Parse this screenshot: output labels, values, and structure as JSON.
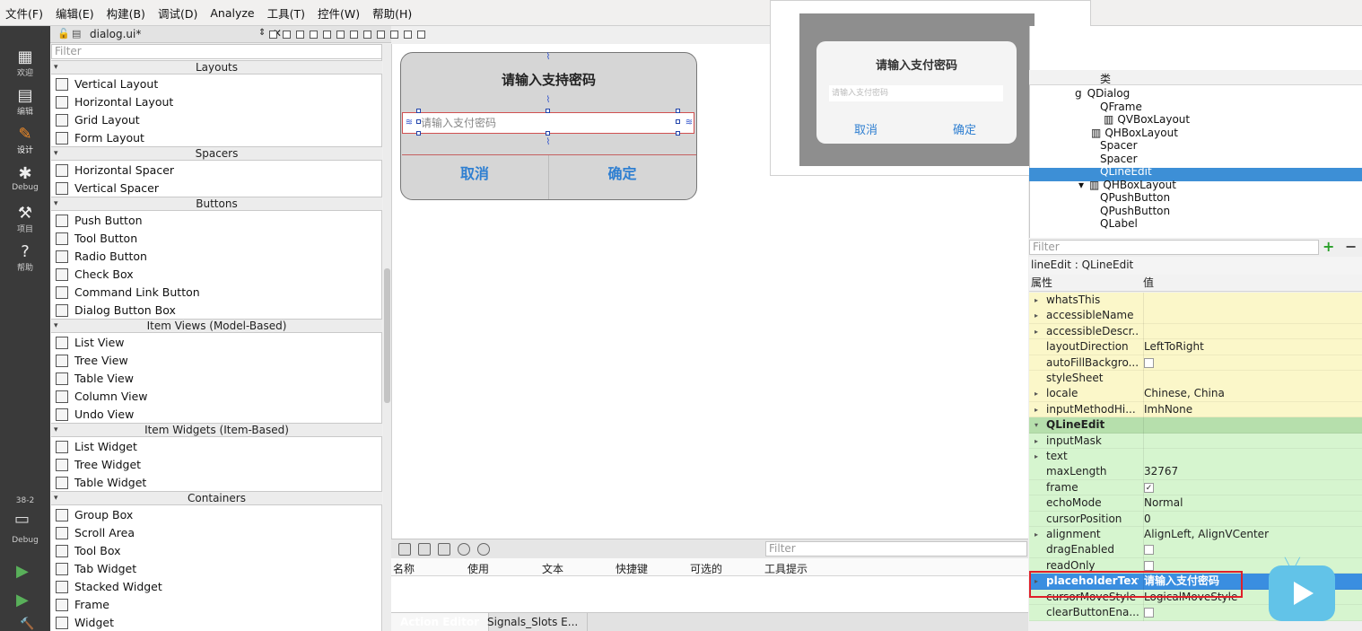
{
  "menubar": [
    "文件(F)",
    "编辑(E)",
    "构建(B)",
    "调试(D)",
    "Analyze",
    "工具(T)",
    "控件(W)",
    "帮助(H)"
  ],
  "modes": [
    {
      "label": "欢迎",
      "icon": "grid-icon"
    },
    {
      "label": "编辑",
      "icon": "document-icon"
    },
    {
      "label": "设计",
      "icon": "pencil-icon"
    },
    {
      "label": "Debug",
      "icon": "bug-icon"
    },
    {
      "label": "项目",
      "icon": "wrench-icon"
    },
    {
      "label": "帮助",
      "icon": "help-icon"
    }
  ],
  "kit": {
    "label": "38-2",
    "mode": "Debug"
  },
  "editor": {
    "file_name": "dialog.ui*"
  },
  "widgetbox": {
    "filter_placeholder": "Filter",
    "categories": [
      {
        "name": "Layouts",
        "items": [
          "Vertical Layout",
          "Horizontal Layout",
          "Grid Layout",
          "Form Layout"
        ]
      },
      {
        "name": "Spacers",
        "items": [
          "Horizontal Spacer",
          "Vertical Spacer"
        ]
      },
      {
        "name": "Buttons",
        "items": [
          "Push Button",
          "Tool Button",
          "Radio Button",
          "Check Box",
          "Command Link Button",
          "Dialog Button Box"
        ]
      },
      {
        "name": "Item Views (Model-Based)",
        "items": [
          "List View",
          "Tree View",
          "Table View",
          "Column View",
          "Undo View"
        ]
      },
      {
        "name": "Item Widgets (Item-Based)",
        "items": [
          "List Widget",
          "Tree Widget",
          "Table Widget"
        ]
      },
      {
        "name": "Containers",
        "items": [
          "Group Box",
          "Scroll Area",
          "Tool Box",
          "Tab Widget",
          "Stacked Widget",
          "Frame",
          "Widget"
        ]
      }
    ]
  },
  "design_dialog": {
    "title": "请输入支持密码",
    "line_placeholder": "请输入支付密码",
    "cancel": "取消",
    "ok": "确定"
  },
  "preview": {
    "title": "请输入支付密码",
    "line_placeholder": "请输入支付密码",
    "cancel": "取消",
    "ok": "确定"
  },
  "action_editor": {
    "filter_placeholder": "Filter",
    "columns": [
      "名称",
      "使用",
      "文本",
      "快捷键",
      "可选的",
      "工具提示"
    ],
    "tabs": [
      "Action Editor",
      "Signals_Slots E..."
    ]
  },
  "object_inspector": {
    "class_header": "类",
    "rows": [
      {
        "text": "QDialog",
        "prefix": "g"
      },
      {
        "text": "QFrame"
      },
      {
        "text": "QVBoxLayout"
      },
      {
        "text": "QHBoxLayout"
      },
      {
        "text": "Spacer"
      },
      {
        "text": "Spacer"
      },
      {
        "text": "QLineEdit",
        "selected": true
      },
      {
        "text": "QHBoxLayout"
      },
      {
        "text": "QPushButton"
      },
      {
        "text": "QPushButton"
      },
      {
        "text": "QLabel"
      }
    ]
  },
  "property_editor": {
    "filter_placeholder": "Filter",
    "object_class": "lineEdit : QLineEdit",
    "headers": [
      "属性",
      "值"
    ],
    "rows": [
      {
        "name": "whatsThis",
        "value": "",
        "style": "yel",
        "expand": true
      },
      {
        "name": "accessibleName",
        "value": "",
        "style": "yel",
        "expand": true
      },
      {
        "name": "accessibleDescr...",
        "value": "",
        "style": "yel",
        "expand": true
      },
      {
        "name": "layoutDirection",
        "value": "LeftToRight",
        "style": "yel"
      },
      {
        "name": "autoFillBackgro...",
        "value": "",
        "style": "yel",
        "check": false
      },
      {
        "name": "styleSheet",
        "value": "",
        "style": "yel"
      },
      {
        "name": "locale",
        "value": "Chinese, China",
        "style": "yel",
        "expand": true
      },
      {
        "name": "inputMethodHi...",
        "value": "ImhNone",
        "style": "yel",
        "expand": true
      },
      {
        "name": "QLineEdit",
        "value": "",
        "style": "grnh",
        "group": true
      },
      {
        "name": "inputMask",
        "value": "",
        "style": "grn",
        "expand": true
      },
      {
        "name": "text",
        "value": "",
        "style": "grn",
        "expand": true
      },
      {
        "name": "maxLength",
        "value": "32767",
        "style": "grn"
      },
      {
        "name": "frame",
        "value": "",
        "style": "grn",
        "check": true
      },
      {
        "name": "echoMode",
        "value": "Normal",
        "style": "grn"
      },
      {
        "name": "cursorPosition",
        "value": "0",
        "style": "grn"
      },
      {
        "name": "alignment",
        "value": "AlignLeft, AlignVCenter",
        "style": "grn",
        "expand": true
      },
      {
        "name": "dragEnabled",
        "value": "",
        "style": "grn",
        "check": false
      },
      {
        "name": "readOnly",
        "value": "",
        "style": "grn",
        "check": false
      },
      {
        "name": "placeholderText",
        "value": "请输入支付密码",
        "style": "sel",
        "expand": true
      },
      {
        "name": "cursorMoveStyle",
        "value": "LogicalMoveStyle",
        "style": "grn"
      },
      {
        "name": "clearButtonEna...",
        "value": "",
        "style": "grn",
        "check": false
      }
    ]
  }
}
